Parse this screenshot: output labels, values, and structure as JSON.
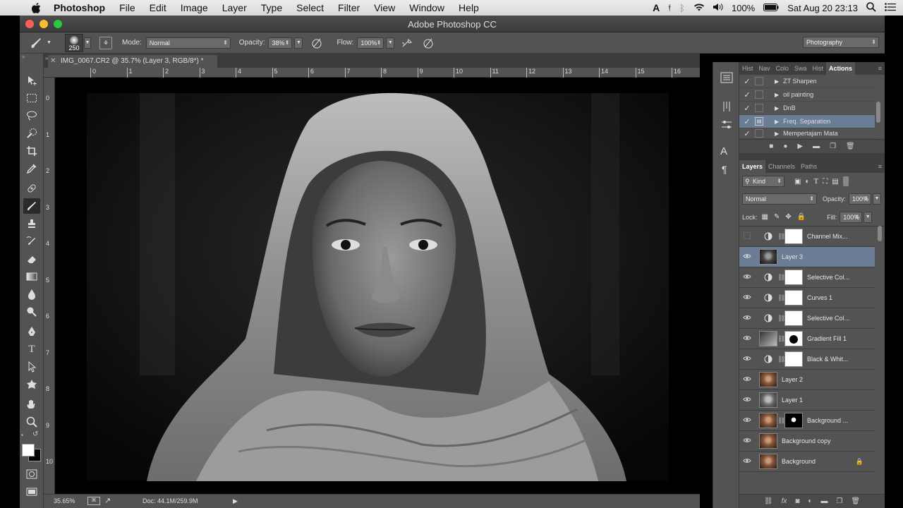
{
  "menubar": {
    "app": "Photoshop",
    "items": [
      "File",
      "Edit",
      "Image",
      "Layer",
      "Type",
      "Select",
      "Filter",
      "View",
      "Window",
      "Help"
    ],
    "battery": "100%",
    "datetime": "Sat Aug 20  23:13"
  },
  "window": {
    "title": "Adobe Photoshop CC"
  },
  "options": {
    "brush_size": "250",
    "mode_label": "Mode:",
    "mode_value": "Normal",
    "opacity_label": "Opacity:",
    "opacity_value": "38%",
    "flow_label": "Flow:",
    "flow_value": "100%",
    "workspace": "Photography"
  },
  "document": {
    "tab_title": "IMG_0067.CR2 @ 35.7% (Layer 3, RGB/8*) *",
    "ruler_h": [
      "0",
      "1",
      "2",
      "3",
      "4",
      "5",
      "6",
      "7",
      "8",
      "9",
      "10",
      "11",
      "12",
      "13",
      "14",
      "15",
      "16"
    ],
    "ruler_v": [
      "0",
      "1",
      "2",
      "3",
      "4",
      "5",
      "6",
      "7",
      "8",
      "9",
      "10",
      "1"
    ],
    "zoom": "35.65%",
    "doc_info": "Doc: 44.1M/259.9M"
  },
  "actions_panel": {
    "tabs": [
      "Hist",
      "Nav",
      "Colo",
      "Swa",
      "Hist",
      "Actions"
    ],
    "active_tab": "Actions",
    "items": [
      {
        "label": "ZT Sharpen",
        "selected": false
      },
      {
        "label": "oil painting",
        "selected": false
      },
      {
        "label": "DnB",
        "selected": false
      },
      {
        "label": "Freq. Separation",
        "selected": true
      },
      {
        "label": "Mempertajam Mata",
        "selected": false
      }
    ]
  },
  "layers_panel": {
    "tabs": [
      "Layers",
      "Channels",
      "Paths"
    ],
    "active_tab": "Layers",
    "kind_label": "Kind",
    "blend_mode": "Normal",
    "opacity_label": "Opacity:",
    "opacity_value": "100%",
    "lock_label": "Lock:",
    "fill_label": "Fill:",
    "fill_value": "100%",
    "layers": [
      {
        "name": "Channel Mix...",
        "type": "adjustment",
        "visible": false,
        "selected": false
      },
      {
        "name": "Layer 3",
        "type": "pixel",
        "visible": true,
        "selected": true
      },
      {
        "name": "Selective Col...",
        "type": "adjustment",
        "visible": true,
        "selected": false
      },
      {
        "name": "Curves 1",
        "type": "adjustment",
        "visible": true,
        "selected": false
      },
      {
        "name": "Selective Col...",
        "type": "adjustment",
        "visible": true,
        "selected": false
      },
      {
        "name": "Gradient Fill 1",
        "type": "gradient",
        "visible": true,
        "selected": false
      },
      {
        "name": "Black & Whit...",
        "type": "adjustment",
        "visible": true,
        "selected": false
      },
      {
        "name": "Layer 2",
        "type": "photo",
        "visible": true,
        "selected": false
      },
      {
        "name": "Layer 1",
        "type": "gray",
        "visible": true,
        "selected": false
      },
      {
        "name": "Background ...",
        "type": "photo-mask",
        "visible": true,
        "selected": false
      },
      {
        "name": "Background copy",
        "type": "photo",
        "visible": true,
        "selected": false
      },
      {
        "name": "Background",
        "type": "photo-locked",
        "visible": true,
        "selected": false
      }
    ]
  },
  "colors": {
    "selection": "#6b7c96",
    "panel_bg": "#535353",
    "dark_bg": "#3c3c3c"
  }
}
